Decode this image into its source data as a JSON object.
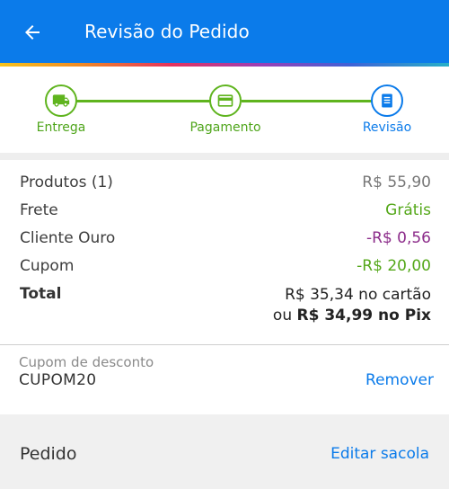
{
  "header": {
    "title": "Revisão do Pedido"
  },
  "stepper": {
    "steps": [
      {
        "label": "Entrega",
        "icon": "truck-icon",
        "state": "done"
      },
      {
        "label": "Pagamento",
        "icon": "credit-card-icon",
        "state": "done"
      },
      {
        "label": "Revisão",
        "icon": "receipt-icon",
        "state": "current"
      }
    ]
  },
  "summary": {
    "products_label": "Produtos (1)",
    "products_value": "R$ 55,90",
    "shipping_label": "Frete",
    "shipping_value": "Grátis",
    "gold_label": "Cliente Ouro",
    "gold_value": "-R$ 0,56",
    "coupon_label": "Cupom",
    "coupon_value": "-R$ 20,00",
    "total_label": "Total",
    "total_card": "R$ 35,34 no cartão",
    "total_pix_prefix": "ou ",
    "total_pix_value": "R$ 34,99 no Pix"
  },
  "coupon": {
    "caption": "Cupom de desconto",
    "code": "CUPOM20",
    "remove_label": "Remover"
  },
  "order": {
    "title": "Pedido",
    "edit_label": "Editar sacola"
  },
  "colors": {
    "primary": "#0B7BEA",
    "success": "#5fb41e",
    "discount_purple": "#8c2c8a"
  }
}
